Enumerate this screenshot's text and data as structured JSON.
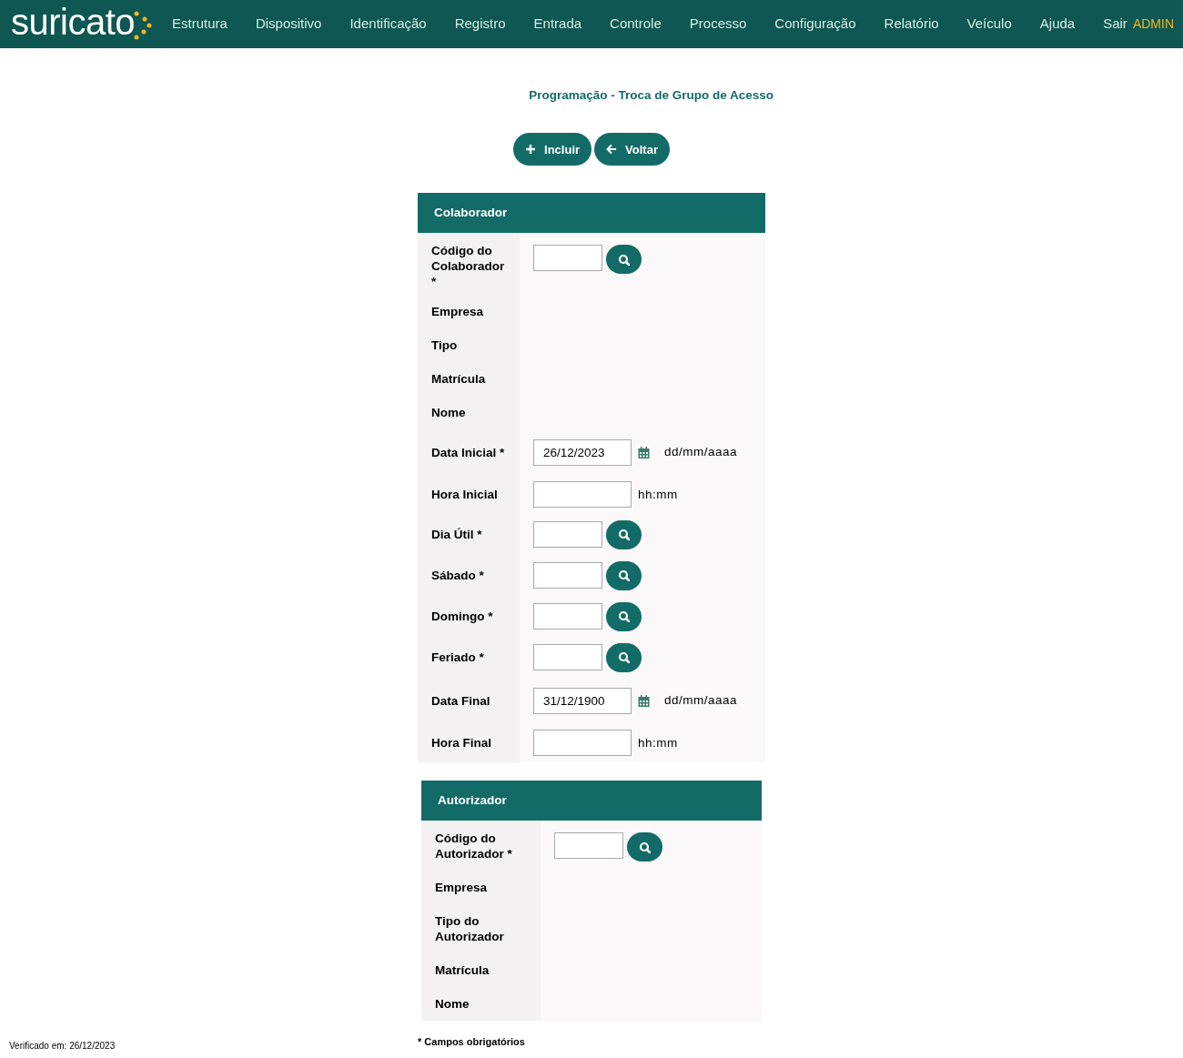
{
  "nav": {
    "logo": "suricato",
    "items": [
      "Estrutura",
      "Dispositivo",
      "Identificação",
      "Registro",
      "Entrada",
      "Controle",
      "Processo",
      "Configuração",
      "Relatório",
      "Veículo",
      "Ajuda",
      "Sair"
    ],
    "user": "ADMIN"
  },
  "page_title": "Programação - Troca de Grupo de Acesso",
  "actions": [
    {
      "kind": "add",
      "label": "Incluir"
    },
    {
      "kind": "back",
      "label": "Voltar"
    }
  ],
  "sections": [
    {
      "title": "Colaborador",
      "fields": [
        {
          "kind": "lookup",
          "label": "Código do Colaborador *"
        },
        {
          "kind": "text",
          "label": "Empresa"
        },
        {
          "kind": "text",
          "label": "Tipo"
        },
        {
          "kind": "text",
          "label": "Matrícula"
        },
        {
          "kind": "text",
          "label": "Nome"
        },
        {
          "kind": "date",
          "label": "Data Inicial *",
          "value": "26/12/2023",
          "hint": "dd/mm/aaaa"
        },
        {
          "kind": "time",
          "label": "Hora Inicial",
          "hint": "hh:mm"
        },
        {
          "kind": "lookup",
          "label": "Dia Útil *"
        },
        {
          "kind": "lookup",
          "label": "Sábado *"
        },
        {
          "kind": "lookup",
          "label": "Domingo *"
        },
        {
          "kind": "lookup",
          "label": "Feriado *"
        },
        {
          "kind": "date",
          "label": "Data Final",
          "value": "31/12/1900",
          "hint": "dd/mm/aaaa"
        },
        {
          "kind": "time",
          "label": "Hora Final",
          "hint": "hh:mm"
        }
      ]
    },
    {
      "title": "Autorizador",
      "fields": [
        {
          "kind": "lookup",
          "label": "Código do Autorizador *"
        },
        {
          "kind": "text",
          "label": "Empresa"
        },
        {
          "kind": "text",
          "label": "Tipo do Autorizador"
        },
        {
          "kind": "text",
          "label": "Matrícula"
        },
        {
          "kind": "text",
          "label": "Nome"
        }
      ]
    }
  ],
  "footnote": "* Campos obrigatórios",
  "verified": "Verificado em: 26/12/2023"
}
